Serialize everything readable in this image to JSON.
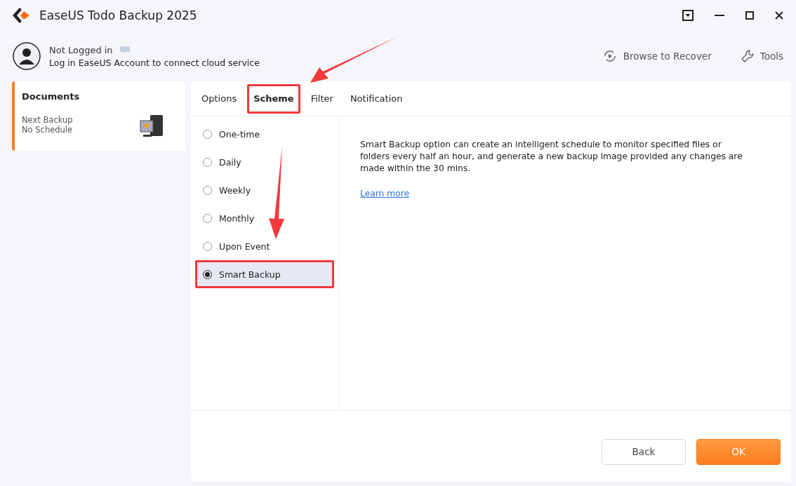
{
  "window": {
    "title": "EaseUS Todo Backup 2025"
  },
  "account": {
    "status": "Not Logged in",
    "hint": "Log in EaseUS Account to connect cloud service"
  },
  "toolbar": [
    "Browse to Recover",
    "Tools"
  ],
  "task": {
    "name": "Documents",
    "next_label": "Next Backup",
    "next_value": "No Schedule",
    "selected": true
  },
  "tabs": [
    {
      "label": "Options",
      "selected": false,
      "highlighted": false
    },
    {
      "label": "Scheme",
      "selected": true,
      "highlighted": true
    },
    {
      "label": "Filter",
      "selected": false,
      "highlighted": false
    },
    {
      "label": "Notification",
      "selected": false,
      "highlighted": false
    }
  ],
  "schemes": [
    {
      "label": "One-time",
      "selected": false,
      "highlighted": false
    },
    {
      "label": "Daily",
      "selected": false,
      "highlighted": false
    },
    {
      "label": "Weekly",
      "selected": false,
      "highlighted": false
    },
    {
      "label": "Monthly",
      "selected": false,
      "highlighted": false
    },
    {
      "label": "Upon Event",
      "selected": false,
      "highlighted": false
    },
    {
      "label": "Smart Backup",
      "selected": true,
      "highlighted": true
    }
  ],
  "description": "Smart Backup option can create an intelligent schedule to monitor specified files or folders every half an hour, and generate a new backup image provided any changes are made within the 30 mins.",
  "link": "Learn more",
  "buttons": [
    "Back",
    "OK"
  ]
}
